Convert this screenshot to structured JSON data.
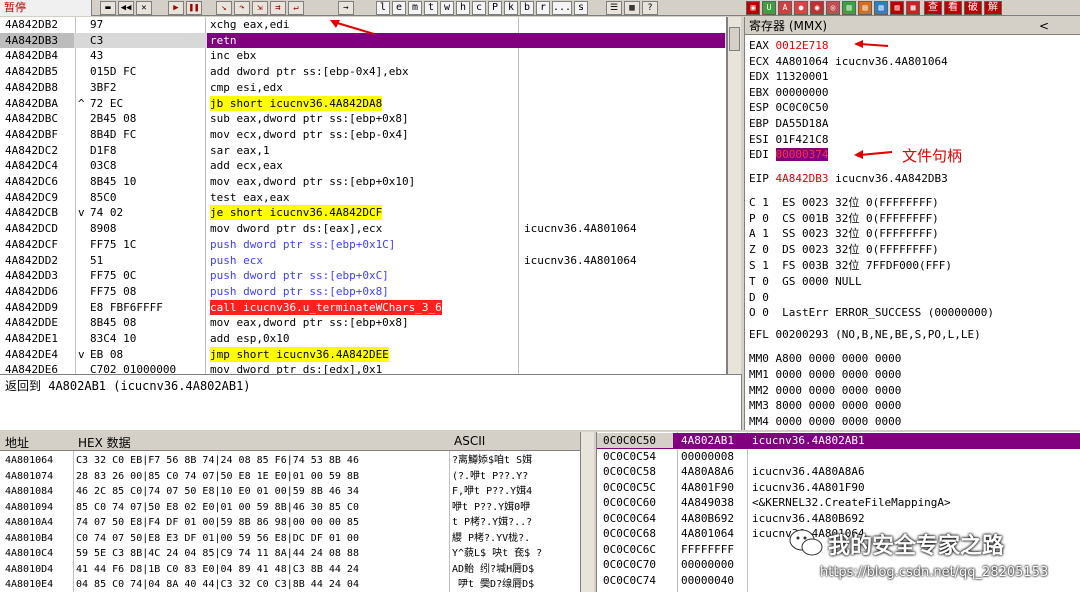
{
  "toolbar": {
    "status": "暂停",
    "letters": [
      "l",
      "e",
      "m",
      "t",
      "w",
      "h",
      "c",
      "P",
      "k",
      "b",
      "r",
      "...",
      "s"
    ],
    "cn_buttons": [
      "查",
      "看",
      "破",
      "解"
    ]
  },
  "disasm": {
    "rows": [
      {
        "addr": "4A842DB2",
        "mark": "",
        "bytes": "97",
        "ins": "xchg eax,edi",
        "cmt": ""
      },
      {
        "addr": "4A842DB3",
        "mark": "",
        "bytes": "C3",
        "ins": "retn",
        "cmt": ""
      },
      {
        "addr": "4A842DB4",
        "mark": "",
        "bytes": "43",
        "ins": "inc ebx",
        "cmt": ""
      },
      {
        "addr": "4A842DB5",
        "mark": "",
        "bytes": "015D FC",
        "ins": "add dword ptr ss:[ebp-0x4],ebx",
        "cmt": ""
      },
      {
        "addr": "4A842DB8",
        "mark": "",
        "bytes": "3BF2",
        "ins": "cmp esi,edx",
        "cmt": ""
      },
      {
        "addr": "4A842DBA",
        "mark": "^",
        "bytes": "72 EC",
        "ins": "jb short icucnv36.4A842DA8",
        "cmt": ""
      },
      {
        "addr": "4A842DBC",
        "mark": "",
        "bytes": "2B45 08",
        "ins": "sub eax,dword ptr ss:[ebp+0x8]",
        "cmt": ""
      },
      {
        "addr": "4A842DBF",
        "mark": "",
        "bytes": "8B4D FC",
        "ins": "mov ecx,dword ptr ss:[ebp-0x4]",
        "cmt": ""
      },
      {
        "addr": "4A842DC2",
        "mark": "",
        "bytes": "D1F8",
        "ins": "sar eax,1",
        "cmt": ""
      },
      {
        "addr": "4A842DC4",
        "mark": "",
        "bytes": "03C8",
        "ins": "add ecx,eax",
        "cmt": ""
      },
      {
        "addr": "4A842DC6",
        "mark": "",
        "bytes": "8B45 10",
        "ins": "mov eax,dword ptr ss:[ebp+0x10]",
        "cmt": ""
      },
      {
        "addr": "4A842DC9",
        "mark": "",
        "bytes": "85C0",
        "ins": "test eax,eax",
        "cmt": ""
      },
      {
        "addr": "4A842DCB",
        "mark": "v",
        "bytes": "74 02",
        "ins": "je short icucnv36.4A842DCF",
        "cmt": ""
      },
      {
        "addr": "4A842DCD",
        "mark": "",
        "bytes": "8908",
        "ins": "mov dword ptr ds:[eax],ecx",
        "cmt": "icucnv36.4A801064"
      },
      {
        "addr": "4A842DCF",
        "mark": "",
        "bytes": "FF75 1C",
        "ins": "push dword ptr ss:[ebp+0x1C]",
        "cmt": ""
      },
      {
        "addr": "4A842DD2",
        "mark": "",
        "bytes": "51",
        "ins": "push ecx",
        "cmt": "icucnv36.4A801064"
      },
      {
        "addr": "4A842DD3",
        "mark": "",
        "bytes": "FF75 0C",
        "ins": "push dword ptr ss:[ebp+0xC]",
        "cmt": ""
      },
      {
        "addr": "4A842DD6",
        "mark": "",
        "bytes": "FF75 08",
        "ins": "push dword ptr ss:[ebp+0x8]",
        "cmt": ""
      },
      {
        "addr": "4A842DD9",
        "mark": "",
        "bytes": "E8 FBF6FFFF",
        "ins": "call icucnv36.u_terminateWChars_3_6",
        "cmt": ""
      },
      {
        "addr": "4A842DDE",
        "mark": "",
        "bytes": "8B45 08",
        "ins": "mov eax,dword ptr ss:[ebp+0x8]",
        "cmt": ""
      },
      {
        "addr": "4A842DE1",
        "mark": "",
        "bytes": "83C4 10",
        "ins": "add esp,0x10",
        "cmt": ""
      },
      {
        "addr": "4A842DE4",
        "mark": "v",
        "bytes": "EB 08",
        "ins": "jmp short icucnv36.4A842DEE",
        "cmt": ""
      },
      {
        "addr": "4A842DE6",
        "mark": "",
        "bytes": "C702 01000000",
        "ins": "mov dword ptr ds:[edx],0x1",
        "cmt": ""
      }
    ]
  },
  "info": {
    "text": "返回到 4A802AB1 (icucnv36.4A802AB1)"
  },
  "registers": {
    "title": "寄存器 (MMX)",
    "chevron": "<",
    "gp": [
      {
        "name": "EAX",
        "value": "0012E718",
        "comment": ""
      },
      {
        "name": "ECX",
        "value": "4A801064",
        "comment": "icucnv36.4A801064"
      },
      {
        "name": "EDX",
        "value": "11320001",
        "comment": ""
      },
      {
        "name": "EBX",
        "value": "00000000",
        "comment": ""
      },
      {
        "name": "ESP",
        "value": "0C0C0C50",
        "comment": ""
      },
      {
        "name": "EBP",
        "value": "DA55D18A",
        "comment": ""
      },
      {
        "name": "ESI",
        "value": "01F421C8",
        "comment": ""
      },
      {
        "name": "EDI",
        "value": "00000374",
        "comment": ""
      }
    ],
    "eip": {
      "name": "EIP",
      "value": "4A842DB3",
      "comment": "icucnv36.4A842DB3"
    },
    "flags": [
      "C 1  ES 0023 32位 0(FFFFFFFF)",
      "P 0  CS 001B 32位 0(FFFFFFFF)",
      "A 1  SS 0023 32位 0(FFFFFFFF)",
      "Z 0  DS 0023 32位 0(FFFFFFFF)",
      "S 1  FS 003B 32位 7FFDF000(FFF)",
      "T 0  GS 0000 NULL",
      "D 0",
      "O 0  LastErr ERROR_SUCCESS (00000000)"
    ],
    "efl": "EFL 00200293 (NO,B,NE,BE,S,PO,L,LE)",
    "mmx": [
      "MM0 A800 0000 0000 0000",
      "MM1 0000 0000 0000 0000",
      "MM2 0000 0000 0000 0000",
      "MM3 8000 0000 0000 0000",
      "MM4 0000 0000 0000 0000"
    ]
  },
  "dump": {
    "headers": {
      "addr": "地址",
      "hex": "HEX 数据",
      "ascii": "ASCII"
    },
    "rows": [
      {
        "addr": "4A801064",
        "hex": "C3 32 C0 EB|F7 56 8B 74|24 08 85 F6|74 53 8B 46",
        "ascii": "?离鱒婖$咱t S媶"
      },
      {
        "addr": "4A801074",
        "hex": "28 83 26 00|85 C0 74 07|50 E8 1E E0|01 00 59 8B",
        "ascii": "(?.咿t P??.Y?"
      },
      {
        "addr": "4A801084",
        "hex": "46 2C 85 C0|74 07 50 E8|10 E0 01 00|59 8B 46 34",
        "ascii": "F,咿t P??.Y媶4"
      },
      {
        "addr": "4A801094",
        "hex": "85 C0 74 07|50 E8 02 E0|01 00 59 8B|46 30 85 C0",
        "ascii": "咿t P??.Y媶0咿"
      },
      {
        "addr": "4A8010A4",
        "hex": "74 07 50 E8|F4 DF 01 00|59 8B 86 98|00 00 00 85",
        "ascii": "t P栲?.Y媶?..?"
      },
      {
        "addr": "4A8010B4",
        "hex": "C0 74 07 50|E8 E3 DF 01|00 59 56 E8|DC DF 01 00",
        "ascii": "纓 P栲?.YV栊?."
      },
      {
        "addr": "4A8010C4",
        "hex": "59 5E C3 8B|4C 24 04 85|C9 74 11 8A|44 24 08 88",
        "ascii": "Y^藐L$ 吷t 奃$ ?"
      },
      {
        "addr": "4A8010D4",
        "hex": "41 44 F6 D8|1B C0 83 E0|04 89 41 48|C3 8B 44 24",
        "ascii": "AD鲐 纼?堿H脣D$"
      },
      {
        "addr": "4A8010E4",
        "hex": "04 85 C0 74|04 8A 40 44|C3 32 C0 C3|8B 44 24 04",
        "ascii": " 吚t 奰D?缐脣D$"
      }
    ]
  },
  "stack": {
    "rows": [
      {
        "addr": "0C0C0C50",
        "value": "4A802AB1",
        "comment": "icucnv36.4A802AB1"
      },
      {
        "addr": "0C0C0C54",
        "value": "00000008",
        "comment": ""
      },
      {
        "addr": "0C0C0C58",
        "value": "4A80A8A6",
        "comment": "icucnv36.4A80A8A6"
      },
      {
        "addr": "0C0C0C5C",
        "value": "4A801F90",
        "comment": "icucnv36.4A801F90"
      },
      {
        "addr": "0C0C0C60",
        "value": "4A849038",
        "comment": "<&KERNEL32.CreateFileMappingA>"
      },
      {
        "addr": "0C0C0C64",
        "value": "4A80B692",
        "comment": "icucnv36.4A80B692"
      },
      {
        "addr": "0C0C0C68",
        "value": "4A801064",
        "comment": "icucnv36.4A801064"
      },
      {
        "addr": "0C0C0C6C",
        "value": "FFFFFFFF",
        "comment": ""
      },
      {
        "addr": "0C0C0C70",
        "value": "00000000",
        "comment": ""
      },
      {
        "addr": "0C0C0C74",
        "value": "00000040",
        "comment": ""
      }
    ]
  },
  "annotations": {
    "edi_label": "文件句柄"
  },
  "watermark": {
    "title": "我的安全专家之路",
    "url": "https://blog.csdn.net/qq_28205153"
  },
  "colors": {
    "eip_highlight": "#800080",
    "annotation": "#e00000",
    "call_highlight": "#ff2020",
    "jump_highlight": "#ffff00"
  }
}
